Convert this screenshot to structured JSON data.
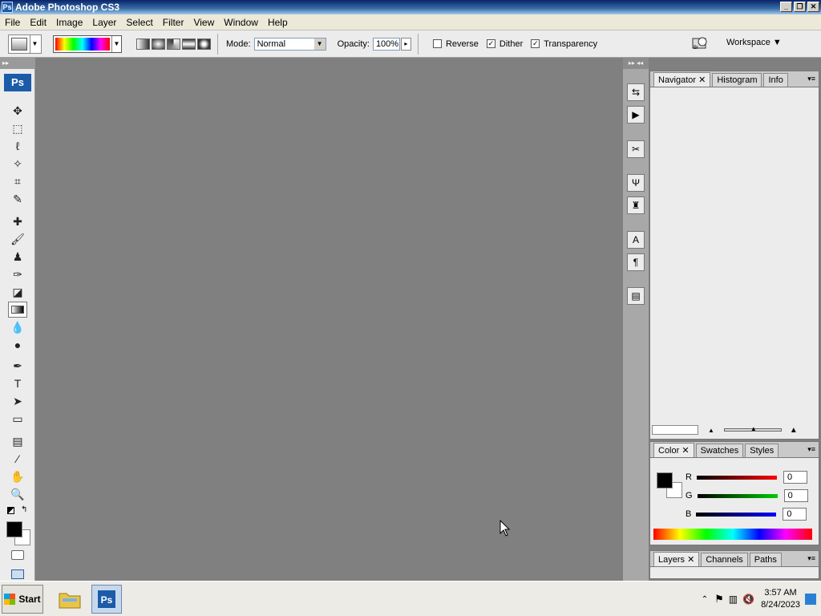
{
  "window": {
    "title": "Adobe Photoshop CS3",
    "ps_badge": "Ps"
  },
  "menu": [
    "File",
    "Edit",
    "Image",
    "Layer",
    "Select",
    "Filter",
    "View",
    "Window",
    "Help"
  ],
  "options": {
    "mode_label": "Mode:",
    "mode_value": "Normal",
    "opacity_label": "Opacity:",
    "opacity_value": "100%",
    "reverse_label": "Reverse",
    "dither_label": "Dither",
    "transparency_label": "Transparency",
    "reverse_checked": false,
    "dither_checked": true,
    "transparency_checked": true,
    "workspace_label": "Workspace"
  },
  "toolbox": {
    "badge": "Ps",
    "active_tool": "gradient-tool"
  },
  "navigator_panel": {
    "tabs": [
      "Navigator",
      "Histogram",
      "Info"
    ],
    "active": "Navigator"
  },
  "color_panel": {
    "tabs": [
      "Color",
      "Swatches",
      "Styles"
    ],
    "active": "Color",
    "r_label": "R",
    "g_label": "G",
    "b_label": "B",
    "r": "0",
    "g": "0",
    "b": "0",
    "foreground": "#000000",
    "background": "#ffffff"
  },
  "layers_panel": {
    "tabs": [
      "Layers",
      "Channels",
      "Paths"
    ],
    "active": "Layers"
  },
  "taskbar": {
    "start_label": "Start",
    "time": "3:57 AM",
    "date": "8/24/2023"
  }
}
